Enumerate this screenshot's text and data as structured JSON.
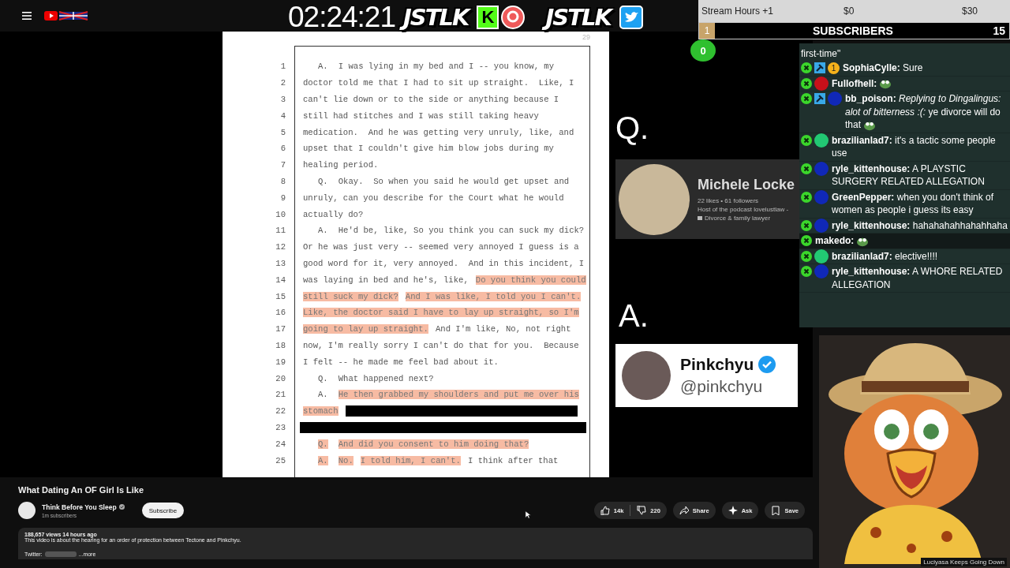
{
  "header": {
    "timer": "02:24:21",
    "brand_logos": [
      {
        "text": "JSTLK",
        "kind": "kick"
      },
      {
        "text": "JSTLK",
        "kind": "twitter"
      }
    ],
    "kick_letter": "K"
  },
  "goal": {
    "label": "Stream Hours +1",
    "start": "$0",
    "end": "$30",
    "rank": "1",
    "title": "SUBSCRIBERS",
    "count": "15",
    "counter": "0"
  },
  "document": {
    "page_number": "29",
    "lines": [
      {
        "number": "1",
        "segments": [
          {
            "kind": "speaker",
            "text": "A.",
            "highlighted": false
          },
          {
            "kind": "text",
            "text": "I was lying in my bed and I -- you know, my",
            "highlighted": false
          }
        ]
      },
      {
        "number": "2",
        "segments": [
          {
            "kind": "text",
            "text": "doctor told me that I had to sit up straight.  Like, I",
            "highlighted": false
          }
        ]
      },
      {
        "number": "3",
        "segments": [
          {
            "kind": "text",
            "text": "can't lie down or to the side or anything because I",
            "highlighted": false
          }
        ]
      },
      {
        "number": "4",
        "segments": [
          {
            "kind": "text",
            "text": "still had stitches and I was still taking heavy",
            "highlighted": false
          }
        ]
      },
      {
        "number": "5",
        "segments": [
          {
            "kind": "text",
            "text": "medication.  And he was getting very unruly, like, and",
            "highlighted": false
          }
        ]
      },
      {
        "number": "6",
        "segments": [
          {
            "kind": "text",
            "text": "upset that I couldn't give him blow jobs during my",
            "highlighted": false
          }
        ]
      },
      {
        "number": "7",
        "segments": [
          {
            "kind": "text",
            "text": "healing period.",
            "highlighted": false
          }
        ]
      },
      {
        "number": "8",
        "segments": [
          {
            "kind": "speaker",
            "text": "Q.",
            "highlighted": false
          },
          {
            "kind": "text",
            "text": "Okay.  So when you said he would get upset and",
            "highlighted": false
          }
        ]
      },
      {
        "number": "9",
        "segments": [
          {
            "kind": "text",
            "text": "unruly, can you describe for the Court what he would",
            "highlighted": false
          }
        ]
      },
      {
        "number": "10",
        "segments": [
          {
            "kind": "text",
            "text": "actually do?",
            "highlighted": false
          }
        ]
      },
      {
        "number": "11",
        "segments": [
          {
            "kind": "speaker",
            "text": "A.",
            "highlighted": false
          },
          {
            "kind": "text",
            "text": "He'd be, like, So you think you can suck my dick?",
            "highlighted": false
          }
        ]
      },
      {
        "number": "12",
        "segments": [
          {
            "kind": "text",
            "text": "Or he was just very -- seemed very annoyed I guess is a",
            "highlighted": false
          }
        ]
      },
      {
        "number": "13",
        "segments": [
          {
            "kind": "text",
            "text": "good word for it, very annoyed.  And in this incident, I",
            "highlighted": false
          }
        ]
      },
      {
        "number": "14",
        "segments": [
          {
            "kind": "text",
            "text": "was laying in bed and he's, like,",
            "highlighted": false
          },
          {
            "kind": "text",
            "text": "Do you think you could",
            "highlighted": true
          }
        ]
      },
      {
        "number": "15",
        "segments": [
          {
            "kind": "text",
            "text": "still suck my dick?",
            "highlighted": true
          },
          {
            "kind": "text",
            "text": "And I was like, I told you I can't.",
            "highlighted": true
          }
        ]
      },
      {
        "number": "16",
        "segments": [
          {
            "kind": "text",
            "text": "Like, the doctor said I have to lay up straight, so I'm",
            "highlighted": true
          }
        ]
      },
      {
        "number": "17",
        "segments": [
          {
            "kind": "text",
            "text": "going to lay up straight.",
            "highlighted": true
          },
          {
            "kind": "text",
            "text": "And I'm like, No, not right",
            "highlighted": false
          }
        ]
      },
      {
        "number": "18",
        "segments": [
          {
            "kind": "text",
            "text": "now, I'm really sorry I can't do that for you.  Because",
            "highlighted": false
          }
        ]
      },
      {
        "number": "19",
        "segments": [
          {
            "kind": "text",
            "text": "I felt -- he made me feel bad about it.",
            "highlighted": false
          }
        ]
      },
      {
        "number": "20",
        "segments": [
          {
            "kind": "speaker",
            "text": "Q.",
            "highlighted": false
          },
          {
            "kind": "text",
            "text": "What happened next?",
            "highlighted": false
          }
        ]
      },
      {
        "number": "21",
        "segments": [
          {
            "kind": "speaker",
            "text": "A.",
            "highlighted": false
          },
          {
            "kind": "text",
            "text": "He then grabbed my shoulders and put me over his",
            "highlighted": true
          }
        ]
      },
      {
        "number": "22",
        "segments": [
          {
            "kind": "text",
            "text": "stomach",
            "highlighted": true
          },
          {
            "kind": "redaction",
            "highlighted": false
          }
        ]
      },
      {
        "number": "23",
        "segments": [
          {
            "kind": "redaction",
            "highlighted": false
          }
        ]
      },
      {
        "number": "24",
        "segments": [
          {
            "kind": "speaker",
            "text": "Q.",
            "highlighted": true
          },
          {
            "kind": "text",
            "text": "And did you consent to him doing that?",
            "highlighted": true
          }
        ]
      },
      {
        "number": "25",
        "segments": [
          {
            "kind": "speaker",
            "text": "A.",
            "highlighted": true
          },
          {
            "kind": "text",
            "text": "No.",
            "highlighted": true
          },
          {
            "kind": "text",
            "text": "I told him, I can't.",
            "highlighted": true
          },
          {
            "kind": "text",
            "text": "I think after that",
            "highlighted": false
          }
        ]
      }
    ]
  },
  "qa": {
    "question_label": "Q.",
    "answer_label": "A.",
    "question_card": {
      "name": "Michele Locke",
      "stats": "22 likes • 61 followers",
      "bio": "Host of the podcast lovelustlaw -",
      "tagline": "Divorce & family lawyer"
    },
    "answer_card": {
      "name": "Pinkchyu",
      "verified": true,
      "handle": "@pinkchyu"
    }
  },
  "chat": {
    "clipped_top": "first-time\"",
    "messages": [
      {
        "badges": [
          {
            "kind": "x"
          },
          {
            "kind": "hammer"
          },
          {
            "kind": "tier",
            "text": "1"
          }
        ],
        "username": "SophiaCylle:",
        "text": "Sure",
        "emote": false,
        "highlighted": false
      },
      {
        "badges": [
          {
            "kind": "x"
          },
          {
            "kind": "dot",
            "color": "#c8101a"
          }
        ],
        "username": "Fullofhell:",
        "emote": true,
        "highlighted": false
      },
      {
        "badges": [
          {
            "kind": "x"
          },
          {
            "kind": "hammer"
          },
          {
            "kind": "dot",
            "color": "#1028b8"
          }
        ],
        "username": "bb_poison:",
        "text": "*Replying to Dingalingus: alot of bitterness :(:* ye divorce will do that",
        "emote": true,
        "highlighted": false
      },
      {
        "badges": [
          {
            "kind": "x"
          },
          {
            "kind": "dot",
            "color": "#22c873"
          }
        ],
        "username": "brazilianlad7:",
        "text": "it's a tactic some people use",
        "emote": false,
        "highlighted": false
      },
      {
        "badges": [
          {
            "kind": "x"
          },
          {
            "kind": "dot",
            "color": "#1028b8"
          }
        ],
        "username": "ryle_kittenhouse:",
        "text": "A PLAYSTIC SURGERY RELATED ALLEGATION",
        "emote": false,
        "highlighted": false
      },
      {
        "badges": [
          {
            "kind": "x"
          },
          {
            "kind": "dot",
            "color": "#1028b8"
          }
        ],
        "username": "GreenPepper:",
        "text": "when you don't think of women as people i guess its easy",
        "emote": false,
        "highlighted": false
      },
      {
        "badges": [
          {
            "kind": "x"
          },
          {
            "kind": "dot",
            "color": "#1028b8"
          }
        ],
        "username": "ryle_kittenhouse:",
        "text": "hahahahahhahahhaha",
        "emote": false,
        "highlighted": false
      },
      {
        "badges": [
          {
            "kind": "x"
          }
        ],
        "username": "makedo:",
        "emote": true,
        "highlighted": true
      },
      {
        "badges": [
          {
            "kind": "x"
          },
          {
            "kind": "dot",
            "color": "#22c873"
          }
        ],
        "username": "brazilianlad7:",
        "text": "elective!!!!",
        "emote": false,
        "highlighted": false
      },
      {
        "badges": [
          {
            "kind": "x"
          },
          {
            "kind": "dot",
            "color": "#1028b8"
          }
        ],
        "username": "ryle_kittenhouse:",
        "text": "A WHORE RELATED ALLEGATION",
        "emote": false,
        "highlighted": false
      }
    ]
  },
  "side_video": {
    "caption": "Luciyasa Keeps Going Down"
  },
  "video": {
    "title": "What Dating An OF Girl Is Like",
    "channel": "Think Before You Sleep",
    "subscribers": "1m subscribers",
    "subscribe": "Subscribe",
    "actions": [
      {
        "kind": "like",
        "label": "14k"
      },
      {
        "kind": "dislike",
        "label": "220"
      },
      {
        "kind": "share",
        "label": "Share"
      },
      {
        "kind": "ask",
        "label": "Ask"
      },
      {
        "kind": "save",
        "label": "Save"
      }
    ],
    "stats": "188,657 views  14 hours ago",
    "description": "This video is about the hearing for an order of protection between Tectone and Pinkchyu.",
    "links_label": "Twitter:",
    "more": "...more"
  }
}
